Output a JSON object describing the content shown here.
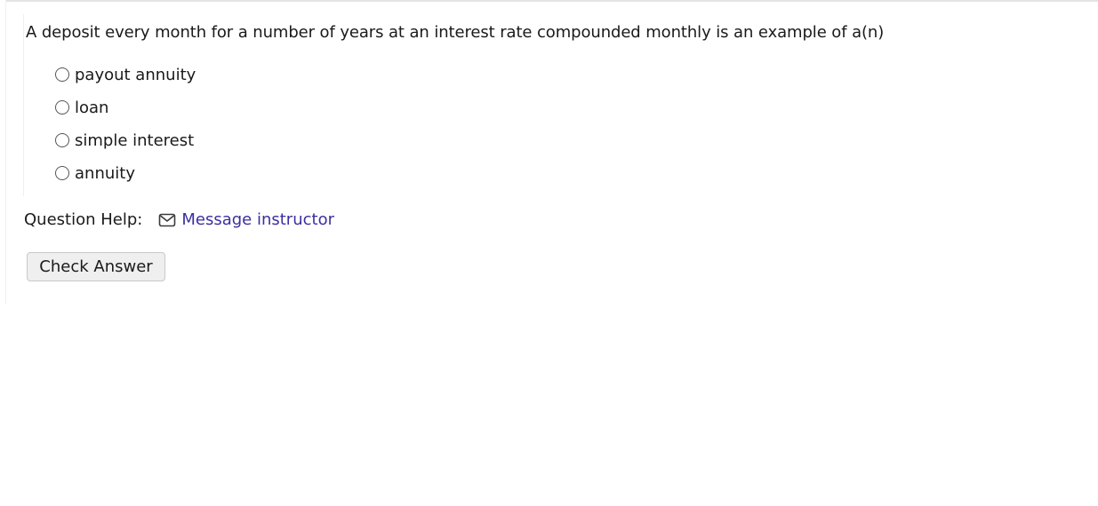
{
  "question": {
    "text": "A deposit every month for a number of years at an interest rate compounded monthly is an example of a(n)",
    "options": [
      {
        "label": "payout annuity",
        "selected": false
      },
      {
        "label": "loan",
        "selected": false
      },
      {
        "label": "simple interest",
        "selected": false
      },
      {
        "label": "annuity",
        "selected": false
      }
    ]
  },
  "help": {
    "label": "Question Help:",
    "icon": "mail-icon",
    "link_label": "Message instructor",
    "link_color": "#3a2fa0"
  },
  "actions": {
    "check_label": "Check Answer"
  }
}
